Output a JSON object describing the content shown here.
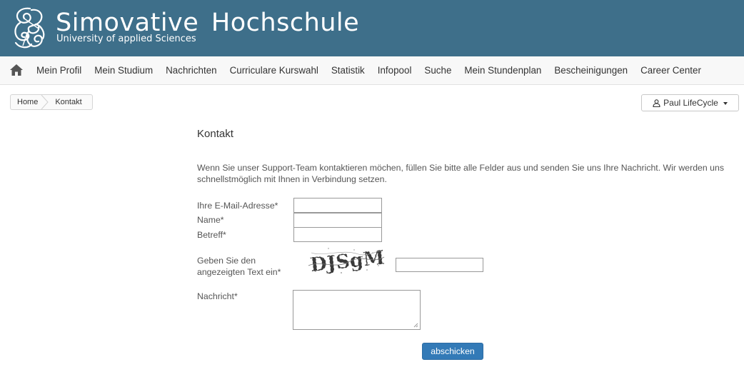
{
  "header": {
    "title": "Simovative Hochschule",
    "subtitle": "University of applied Sciences",
    "logo_icon": "swirl-logo-icon",
    "background": "#3e6f8a"
  },
  "nav": {
    "home_icon": "home-icon",
    "items": [
      "Mein Profil",
      "Mein Studium",
      "Nachrichten",
      "Curriculare Kurswahl",
      "Statistik",
      "Infopool",
      "Suche",
      "Mein Stundenplan",
      "Bescheinigungen",
      "Career Center"
    ]
  },
  "breadcrumb": {
    "home": "Home",
    "current": "Kontakt"
  },
  "user_menu": {
    "label": "Paul LifeCycle",
    "icon": "user-icon"
  },
  "form": {
    "title": "Kontakt",
    "intro": "Wenn Sie unser Support-Team kontaktieren möchen, füllen Sie bitte alle Felder aus und senden Sie uns Ihre Nachricht. Wir werden uns schnellstmöglich mit Ihnen in Verbindung setzen.",
    "email_label": "Ihre E-Mail-Adresse*",
    "email_value": "",
    "name_label": "Name*",
    "name_value": "",
    "subject_label": "Betreff*",
    "subject_value": "",
    "captcha_label_line1": "Geben Sie den",
    "captcha_label_line2": "angezeigten Text ein*",
    "captcha_text": "DJSgM",
    "captcha_value": "",
    "message_label": "Nachricht*",
    "message_value": "",
    "submit_label": "abschicken",
    "submit_color": "#337ab7"
  }
}
